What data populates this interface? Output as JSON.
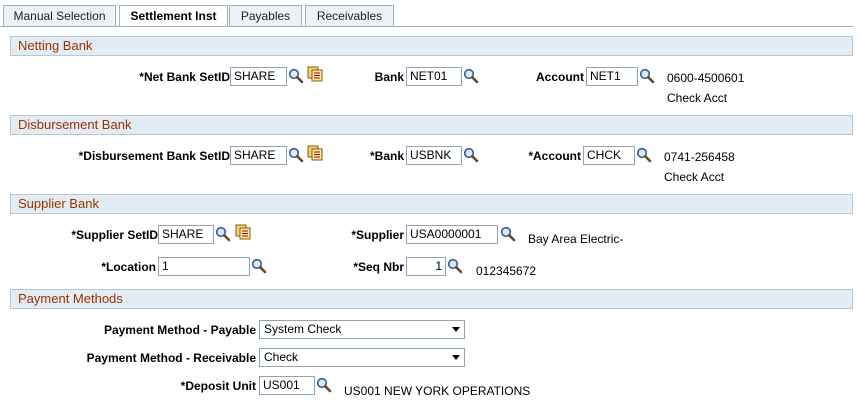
{
  "tabs": [
    {
      "label": "Manual Selection"
    },
    {
      "label": "Settlement Inst"
    },
    {
      "label": "Payables"
    },
    {
      "label": "Receivables"
    }
  ],
  "netting": {
    "title": "Netting Bank",
    "setid_label": "*Net Bank SetID",
    "setid": "SHARE",
    "bank_label": "Bank",
    "bank": "NET01",
    "account_label": "Account",
    "account": "NET1",
    "acct_number": "0600-4500601",
    "acct_desc": "Check Acct"
  },
  "disbursement": {
    "title": "Disbursement Bank",
    "setid_label": "*Disbursement Bank SetID",
    "setid": "SHARE",
    "bank_label": "*Bank",
    "bank": "USBNK",
    "account_label": "*Account",
    "account": "CHCK",
    "acct_number": "0741-256458",
    "acct_desc": "Check Acct"
  },
  "supplier": {
    "title": "Supplier Bank",
    "setid_label": "*Supplier SetID",
    "setid": "SHARE",
    "supplier_label": "*Supplier",
    "supplier": "USA0000001",
    "supplier_name": "Bay Area Electric-",
    "location_label": "*Location",
    "location": "1",
    "seq_label": "*Seq Nbr",
    "seq": "1",
    "seq_desc": "012345672"
  },
  "payment": {
    "title": "Payment Methods",
    "payable_label": "Payment Method - Payable",
    "payable": "System Check",
    "receivable_label": "Payment Method - Receivable",
    "receivable": "Check",
    "deposit_label": "*Deposit Unit",
    "deposit": "US001",
    "deposit_desc": "US001 NEW YORK OPERATIONS"
  },
  "colors": {
    "section_bg": "#e3ebf3",
    "section_text": "#993300",
    "tab_border": "#9cb0c8"
  }
}
